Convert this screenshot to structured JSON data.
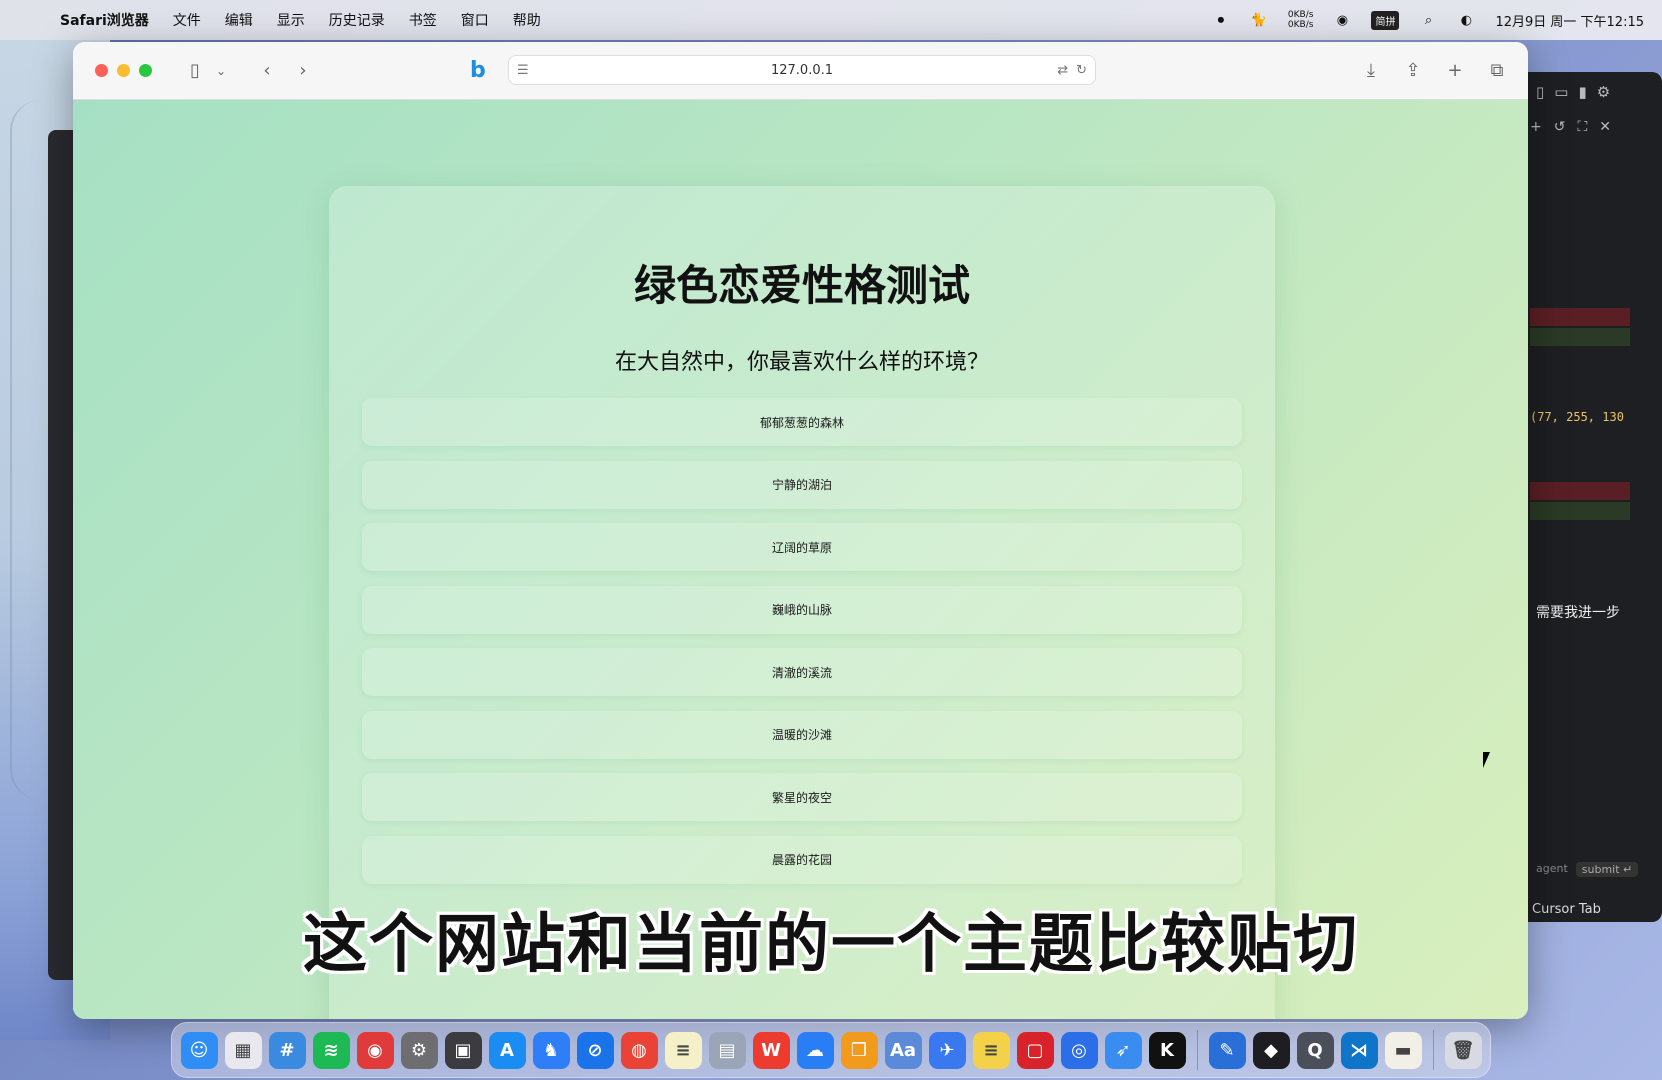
{
  "menubar": {
    "app_name": "Safari浏览器",
    "items": [
      "文件",
      "编辑",
      "显示",
      "历史记录",
      "书签",
      "窗口",
      "帮助"
    ],
    "net_up": "0KB/s",
    "net_down": "0KB/s",
    "ime": "简拼",
    "datetime": "12月9日 周一 下午12:15"
  },
  "browser": {
    "url": "127.0.0.1",
    "bing_label": "b"
  },
  "quiz": {
    "title": "绿色恋爱性格测试",
    "question": "在大自然中，你最喜欢什么样的环境？",
    "options": [
      "郁郁葱葱的森林",
      "宁静的湖泊",
      "辽阔的草原",
      "巍峨的山脉",
      "清澈的溪流",
      "温暖的沙滩",
      "繁星的夜空",
      "晨露的花园"
    ]
  },
  "editor": {
    "code_snippet": "(77, 255, 130",
    "chat_hint": "需要我进一步",
    "agent_label": "agent",
    "submit_label": "submit ↵",
    "cursor_tab_label": "Cursor Tab"
  },
  "subtitle": "这个网站和当前的一个主题比较贴切",
  "colors": {
    "page_gradient_start": "#a6e0c4",
    "page_gradient_end": "#d9efbd",
    "traffic_red": "#ff5f57",
    "traffic_yellow": "#febc2e",
    "traffic_green": "#28c840"
  },
  "dock": [
    {
      "name": "finder-icon",
      "color": "#2f8ef5",
      "glyph": "☺"
    },
    {
      "name": "launchpad-icon",
      "color": "#e8e8ee",
      "glyph": "▦"
    },
    {
      "name": "app-icon",
      "color": "#3a8be0",
      "glyph": "#"
    },
    {
      "name": "spotify-icon",
      "color": "#1db954",
      "glyph": "≋"
    },
    {
      "name": "netease-music-icon",
      "color": "#e03a3a",
      "glyph": "◉"
    },
    {
      "name": "system-settings-icon",
      "color": "#6d6d72",
      "glyph": "⚙"
    },
    {
      "name": "screenshot-icon",
      "color": "#3c3c40",
      "glyph": "▣"
    },
    {
      "name": "app-store-icon",
      "color": "#1b8cf2",
      "glyph": "A"
    },
    {
      "name": "qq-icon",
      "color": "#2d7ef7",
      "glyph": "♞"
    },
    {
      "name": "safari-icon",
      "color": "#1a73e8",
      "glyph": "⊘"
    },
    {
      "name": "chrome-icon",
      "color": "#ea4335",
      "glyph": "◍"
    },
    {
      "name": "notes-icon",
      "color": "#f5f0c8",
      "glyph": "≡"
    },
    {
      "name": "preview-icon",
      "color": "#9aa5b8",
      "glyph": "▤"
    },
    {
      "name": "wps-icon",
      "color": "#ee3b2f",
      "glyph": "W"
    },
    {
      "name": "tencent-meeting-icon",
      "color": "#2a7ef5",
      "glyph": "☁"
    },
    {
      "name": "books-icon",
      "color": "#f29a1c",
      "glyph": "❒"
    },
    {
      "name": "dictionary-icon",
      "color": "#5a8ad8",
      "glyph": "Aa"
    },
    {
      "name": "feishu-icon",
      "color": "#3a78f0",
      "glyph": "✈"
    },
    {
      "name": "stickies-icon",
      "color": "#f3d24a",
      "glyph": "≡"
    },
    {
      "name": "photo-booth-icon",
      "color": "#d8232a",
      "glyph": "▢"
    },
    {
      "name": "copilot-icon",
      "color": "#2b6ee8",
      "glyph": "◎"
    },
    {
      "name": "bird-app-icon",
      "color": "#3a8df0",
      "glyph": "➶"
    },
    {
      "name": "k-app-icon",
      "color": "#111111",
      "glyph": "K"
    },
    {
      "name": "xcode-icon",
      "color": "#2a6fd8",
      "glyph": "✎"
    },
    {
      "name": "cursor-app-icon",
      "color": "#1e1e22",
      "glyph": "◆"
    },
    {
      "name": "quicktime-icon",
      "color": "#4a4f5a",
      "glyph": "Q"
    },
    {
      "name": "vscode-icon",
      "color": "#0e75c9",
      "glyph": "⋊"
    },
    {
      "name": "notes-stack-icon",
      "color": "#f2f0e6",
      "glyph": "▬"
    },
    {
      "name": "trash-icon",
      "color": "#d7dae2",
      "glyph": "🗑"
    }
  ]
}
